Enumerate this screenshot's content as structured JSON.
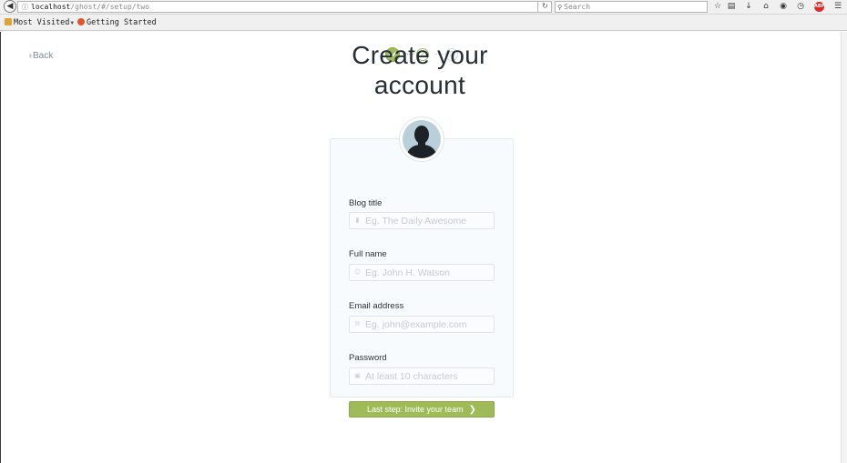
{
  "browser": {
    "url_host": "localhost",
    "url_path": "/ghost/#/setup/two",
    "search_placeholder": "Search",
    "bookmarks": [
      {
        "label": "Most Visited"
      },
      {
        "label": "Getting Started"
      }
    ],
    "abp_badge": "ABP"
  },
  "nav": {
    "back_label": "Back"
  },
  "steps": {
    "current_label": "2",
    "next_label": "3"
  },
  "heading": {
    "line1": "Create your",
    "line2": "account"
  },
  "form": {
    "blog_title": {
      "label": "Blog title",
      "placeholder": "Eg. The Daily Awesome",
      "icon": "book-icon"
    },
    "full_name": {
      "label": "Full name",
      "placeholder": "Eg. John H. Watson",
      "icon": "user-icon"
    },
    "email": {
      "label": "Email address",
      "placeholder": "Eg. john@example.com",
      "icon": "mail-icon"
    },
    "password": {
      "label": "Password",
      "placeholder": "At least 10 characters",
      "icon": "lock-icon"
    },
    "submit_label": "Last step: Invite your team"
  },
  "colors": {
    "accent_green": "#9fbb58",
    "heading_text": "#242e34",
    "muted_text": "#7d8b94"
  }
}
